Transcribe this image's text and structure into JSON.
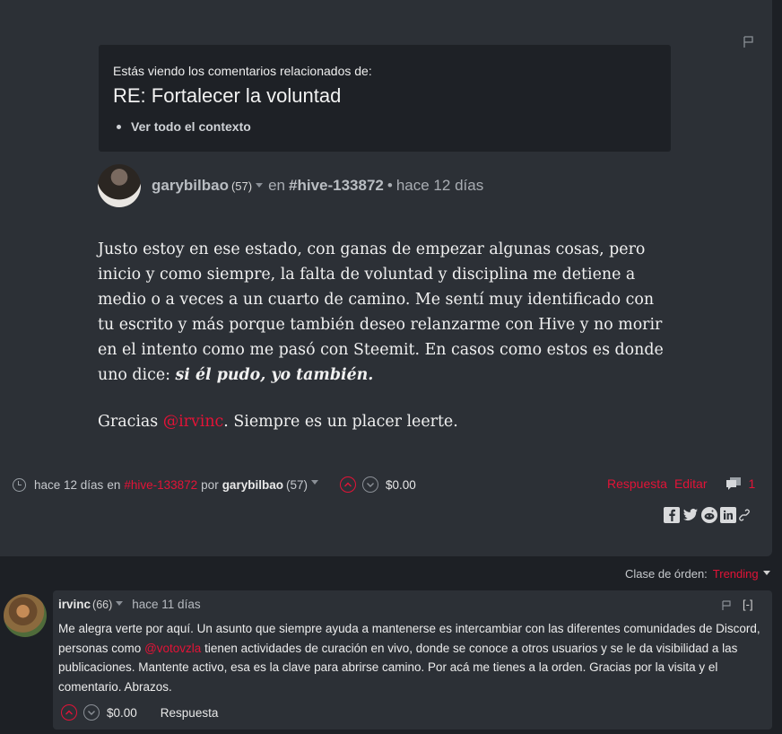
{
  "context": {
    "intro": "Estás viendo los comentarios relacionados de:",
    "title": "RE: Fortalecer la voluntad",
    "link": "Ver todo el contexto"
  },
  "post": {
    "author": "garybilbao",
    "reputation": "(57)",
    "in_label": "en",
    "community": "#hive-133872",
    "separator": "•",
    "time": "hace 12 días",
    "body_p1": "Justo estoy en ese estado, con ganas de empezar algunas cosas, pero inicio y como siempre, la falta de voluntad y disciplina me detiene a medio o a veces a un cuarto de camino. Me sentí muy identificado con tu escrito y más porque también deseo relanzarme con Hive y no morir en el intento como me pasó con Steemit. En casos como estos es donde uno dice:",
    "body_p1_emphasis": "si él pudo, yo también.",
    "body_p2_start": "Gracias",
    "body_p2_mention": "@irvinc",
    "body_p2_end": ". Siempre es un placer leerte."
  },
  "post_footer": {
    "time": "hace 12 días",
    "in_label": "en",
    "community": "#hive-133872",
    "by_label": "por",
    "author": "garybilbao",
    "reputation": "(57)",
    "payout": "$0.00",
    "reply_label": "Respuesta",
    "edit_label": "Editar",
    "comment_count": "1"
  },
  "sort": {
    "label": "Clase de órden:",
    "value": "Trending"
  },
  "reply": {
    "author": "irvinc",
    "reputation": "(66)",
    "time": "hace 11 días",
    "collapse": "[-]",
    "body_start": "Me alegra verte por aquí. Un asunto que siempre ayuda a mantenerse es intercambiar con las diferentes comunidades de Discord, personas como",
    "body_mention": "@votovzla",
    "body_end": "tienen actividades de curación en vivo, donde se conoce a otros usuarios y se le da visibilidad a las publicaciones. Mantente activo, esa es la clave para abrirse camino. Por acá me tienes a la orden. Gracias por la visita y el comentario. Abrazos.",
    "payout": "$0.00",
    "reply_label": "Respuesta"
  },
  "icons": {
    "flag": "flag-icon",
    "clock": "clock-icon",
    "upvote": "upvote-icon",
    "downvote": "downvote-icon",
    "comments": "comments-icon",
    "facebook": "facebook-icon",
    "twitter": "twitter-icon",
    "reddit": "reddit-icon",
    "linkedin": "linkedin-icon",
    "permalink": "link-icon"
  },
  "colors": {
    "accent": "#e31337",
    "background": "#1d2025",
    "card": "#2c3036"
  }
}
